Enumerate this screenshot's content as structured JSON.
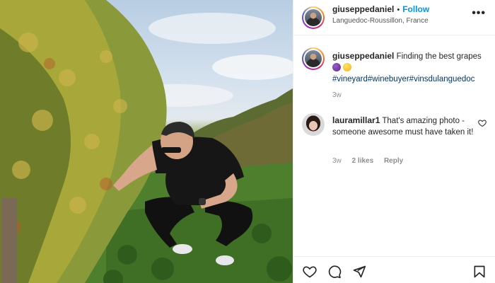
{
  "post": {
    "author": "giuseppedaniel",
    "follow_label": "Follow",
    "location": "Languedoc-Roussillon, France",
    "more_label": "•••"
  },
  "caption": {
    "author": "giuseppedaniel",
    "text": "Finding the best grapes",
    "emojis": [
      "grapes-emoji",
      "rofl-emoji"
    ],
    "hashtags": "#vineyard#winebuyer#vinsdulanguedoc",
    "age": "3w"
  },
  "comment": {
    "author": "lauramillar1",
    "text": "That's amazing photo - someone awesome must have taken it!",
    "age": "3w",
    "likes": "2 likes",
    "reply_label": "Reply"
  },
  "actions": [
    "heart-icon",
    "comment-icon",
    "share-icon",
    "bookmark-icon"
  ],
  "colors": {
    "link": "#0095f6",
    "hashtag": "#00376b",
    "muted": "#8e8e8e",
    "text": "#262626"
  }
}
